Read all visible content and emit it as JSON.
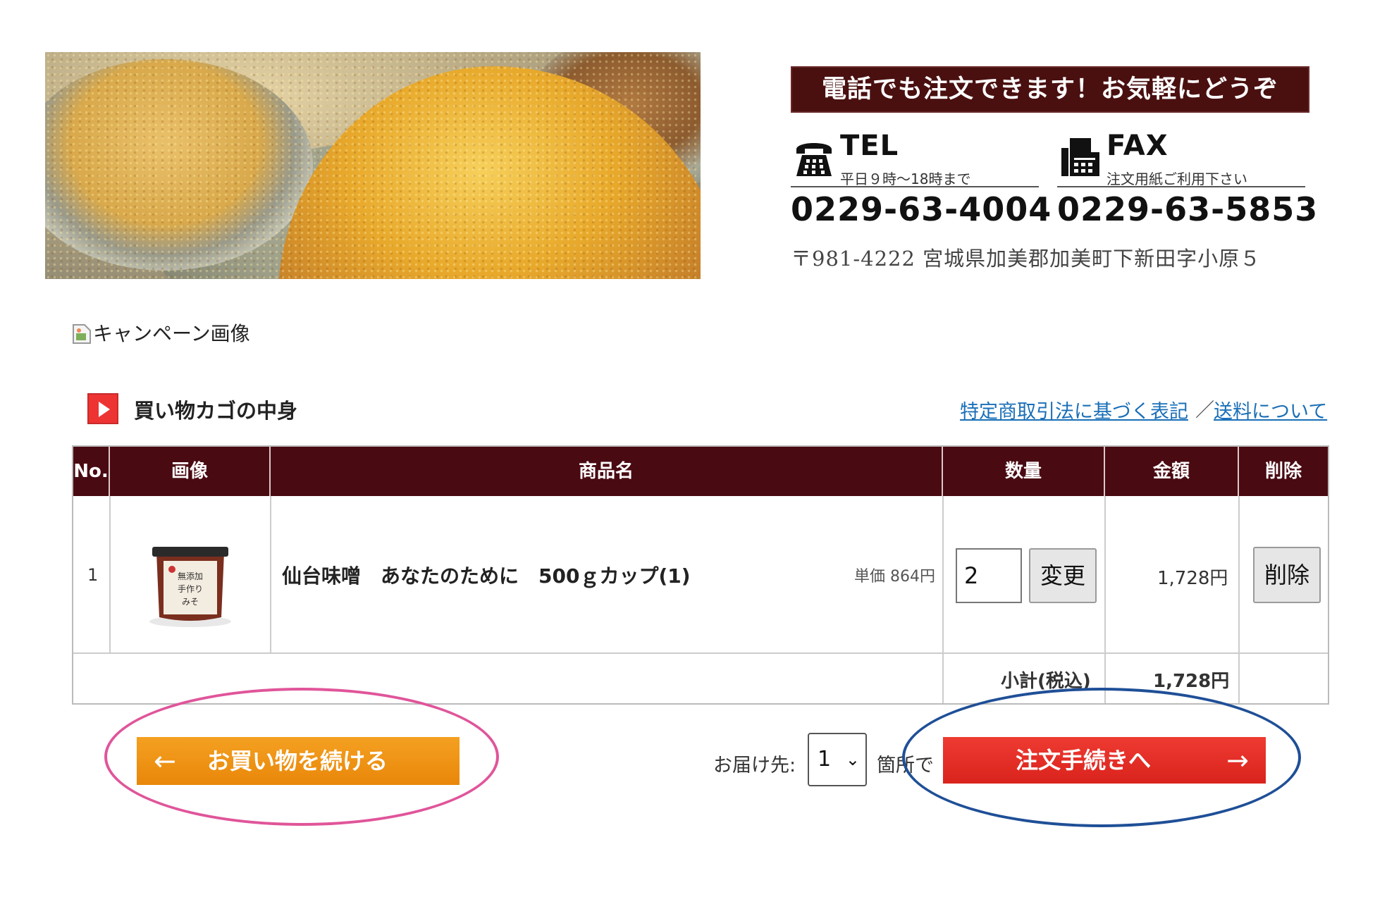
{
  "header": {
    "contact_banner": "電話でも注文できます！お気軽にどうぞ",
    "tel": {
      "label": "TEL",
      "note": "平日９時～18時まで",
      "number": "0229-63-4004"
    },
    "fax": {
      "label": "FAX",
      "note": "注文用紙ご利用下さい",
      "number": "0229-63-5853"
    },
    "address": "〒981-4222 宮城県加美郡加美町下新田字小原５"
  },
  "campaign": {
    "alt_text": "キャンペーン画像"
  },
  "cart": {
    "title": "買い物カゴの中身",
    "links": {
      "legal": "特定商取引法に基づく表記",
      "separator": "／",
      "shipping": "送料について"
    },
    "columns": [
      "No.",
      "画像",
      "商品名",
      "数量",
      "金額",
      "削除"
    ],
    "items": [
      {
        "no": "1",
        "name": "仙台味噌　あなたのために　500ｇカップ(1)",
        "unit_price": "単価 864円",
        "quantity": "2",
        "change_label": "変更",
        "amount": "1,728円",
        "delete_label": "削除",
        "label_lines": [
          "無添加",
          "手作り",
          "みそ"
        ]
      }
    ],
    "subtotal_label": "小計(税込)",
    "subtotal_value": "1,728円"
  },
  "actions": {
    "continue_label": "お買い物を続ける",
    "continue_arrow": "←",
    "delivery_prefix": "お届け先:",
    "delivery_selected": "1",
    "delivery_suffix": "箇所で",
    "order_label": "注文手続きへ",
    "order_arrow": "→"
  },
  "colors": {
    "table_header": "#4a0a12",
    "continue_button": "#ef8f12",
    "order_button": "#e52b23",
    "link": "#1a6fb7",
    "annotation_pink": "#e0559a",
    "annotation_blue": "#1f4f97"
  }
}
